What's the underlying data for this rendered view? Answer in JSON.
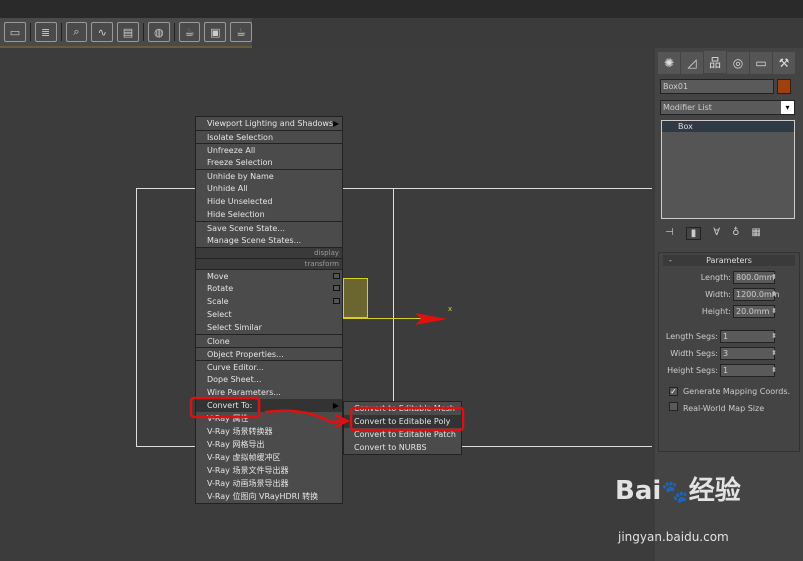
{
  "toolbar": {
    "icons": [
      "layer-icon",
      "layer-manager-icon",
      "scene-explorer-icon",
      "curve-editor-icon",
      "schematic-view-icon",
      "material-editor-icon",
      "render-setup-icon",
      "rendered-frame-icon",
      "render-icon"
    ]
  },
  "menu": {
    "items": [
      "Viewport Lighting and Shadows",
      "Isolate Selection",
      "Unfreeze All",
      "Freeze Selection",
      "Unhide by Name",
      "Unhide All",
      "Hide Unselected",
      "Hide Selection",
      "Save Scene State...",
      "Manage Scene States..."
    ],
    "display_header": "display",
    "transform_header": "transform",
    "transform_items": [
      "Move",
      "Rotate",
      "Scale",
      "Select",
      "Select Similar",
      "Clone",
      "Object Properties...",
      "Curve Editor...",
      "Dope Sheet...",
      "Wire Parameters...",
      "Convert To:",
      "V-Ray 属性",
      "V-Ray 场景转换器",
      "V-Ray 网格导出",
      "V-Ray 虚拟帧缓冲区",
      "V-Ray 场景文件导出器",
      "V-Ray 动画场景导出器",
      "V-Ray 位图向 VRayHDRI 转换"
    ]
  },
  "submenu": {
    "items": [
      "Convert to Editable Mesh",
      "Convert to Editable Poly",
      "Convert to Editable Patch",
      "Convert to NURBS"
    ]
  },
  "viewport": {
    "axis_label": "x",
    "annotation_color": "#e01010"
  },
  "panel": {
    "object_name": "Box01",
    "object_color": "#a0400c",
    "modifier_list": "Modifier List",
    "stack": [
      "Box"
    ],
    "rollout_title": "Parameters",
    "rollout_toggle": "-",
    "params": [
      {
        "label": "Length:",
        "value": "800.0mm"
      },
      {
        "label": "Width:",
        "value": "1200.0mm"
      },
      {
        "label": "Height:",
        "value": "20.0mm"
      },
      {
        "label": "Length Segs:",
        "value": "1"
      },
      {
        "label": "Width Segs:",
        "value": "3"
      },
      {
        "label": "Height Segs:",
        "value": "1"
      }
    ],
    "gen_mapping": "Generate Mapping Coords.",
    "gen_mapping_checked": true,
    "real_world": "Real-World Map Size",
    "real_world_checked": false
  },
  "watermark": {
    "brand": "Bai du 经验",
    "url": "jingyan.baidu.com"
  }
}
